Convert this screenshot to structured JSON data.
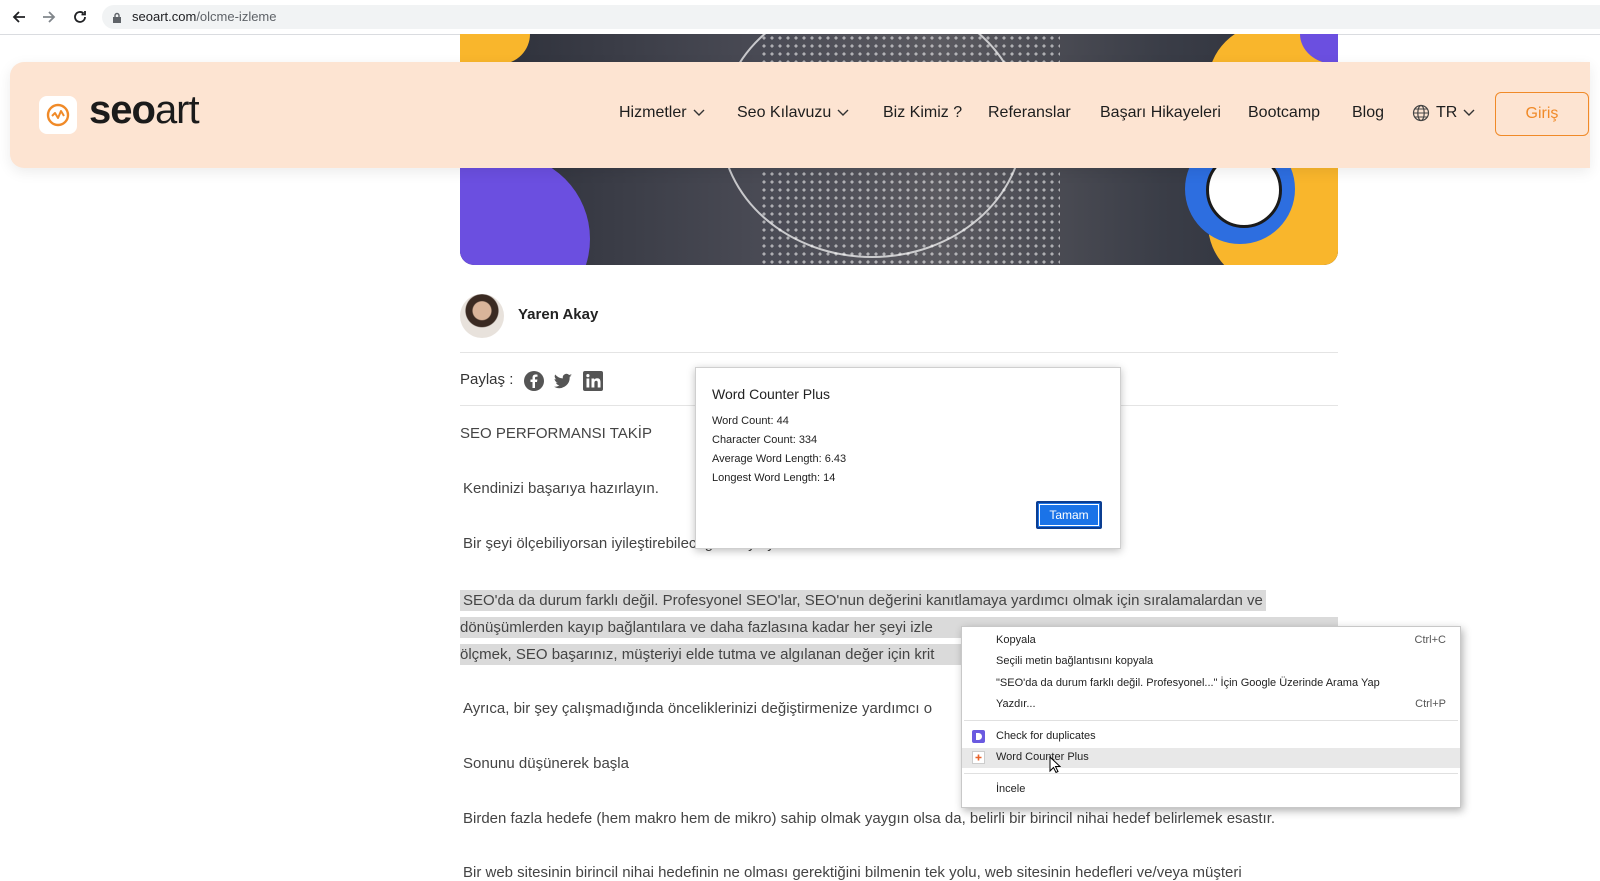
{
  "browser": {
    "url_domain": "seoart.com",
    "url_path": "/olcme-izleme"
  },
  "header": {
    "logo_bold": "seo",
    "logo_light": "art",
    "nav": [
      {
        "label": "Hizmetler"
      },
      {
        "label": "Seo Kılavuzu"
      },
      {
        "label": "Biz Kimiz ?"
      },
      {
        "label": "Referanslar"
      },
      {
        "label": "Başarı Hikayeleri"
      },
      {
        "label": "Bootcamp"
      },
      {
        "label": "Blog"
      }
    ],
    "language": "TR",
    "login_label": "Giriş",
    "accent_color": "#f08a28",
    "background_color": "#fde4d2"
  },
  "article": {
    "author": "Yaren Akay",
    "share_label": "Paylaş :",
    "share_icons": [
      "facebook-icon",
      "twitter-icon",
      "linkedin-icon"
    ],
    "paragraphs": [
      "SEO PERFORMANSI TAKİP",
      "Kendinizi başarıya hazırlayın.",
      "Bir şeyi ölçebiliyorsan iyileştirebileceğini söylüyorlar.",
      "SEO'da da durum farklı değil.  Profesyonel SEO'lar, SEO'nun değerini kanıtlamaya yardımcı olmak için sıralamalardan ve",
      "dönüşümlerden kayıp bağlantılara ve daha fazlasına kadar her şeyi izle",
      "ölçmek, SEO başarınız, müşteriyi elde tutma ve algılanan değer için krit",
      "Ayrıca, bir şey çalışmadığında önceliklerinizi değiştirmenize yardımcı o",
      "Sonunu düşünerek başla",
      "Birden fazla hedefe (hem makro hem de mikro) sahip olmak yaygın olsa da, belirli bir birincil nihai hedef belirlemek esastır.",
      "Bir web sitesinin birincil nihai hedefinin ne olması gerektiğini bilmenin tek yolu, web sitesinin hedefleri ve/veya müşteri"
    ]
  },
  "word_counter_popup": {
    "title": "Word Counter Plus",
    "word_count": "Word Count: 44",
    "character_count": "Character Count: 334",
    "average_word_length": "Average Word Length: 6.43",
    "longest_word_length": "Longest Word Length: 14",
    "ok_label": "Tamam"
  },
  "context_menu": {
    "items": [
      {
        "label": "Kopyala",
        "shortcut": "Ctrl+C"
      },
      {
        "label": "Seçili metin bağlantısını kopyala",
        "shortcut": ""
      },
      {
        "label": "\"SEO'da da durum farklı değil.  Profesyonel...\" İçin Google Üzerinde Arama Yap",
        "shortcut": ""
      },
      {
        "label": "Yazdır...",
        "shortcut": "Ctrl+P"
      },
      {
        "label": "Check for duplicates",
        "shortcut": ""
      },
      {
        "label": "Word Counter Plus",
        "shortcut": ""
      },
      {
        "label": "İncele",
        "shortcut": ""
      }
    ]
  }
}
